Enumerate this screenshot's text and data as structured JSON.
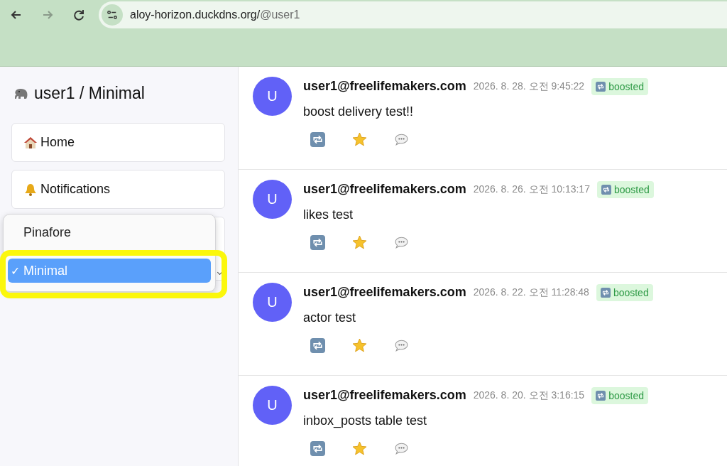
{
  "browser": {
    "url_host": "aloy-horizon.duckdns.org/",
    "url_path": "@user1"
  },
  "sidebar": {
    "title": "user1 / Minimal",
    "nav": [
      {
        "label": "Home",
        "kind": "home"
      },
      {
        "label": "Notifications",
        "kind": "bell"
      }
    ],
    "theme_menu": {
      "options": [
        {
          "label": "Pinafore",
          "selected": false
        },
        {
          "label": "Minimal",
          "selected": true
        }
      ],
      "check": "✓"
    }
  },
  "posts": [
    {
      "avatar": "U",
      "author": "user1@freelifemakers.com",
      "time": "2026. 8. 28. 오전 9:45:22",
      "badge": "boosted",
      "text": "boost delivery test!!"
    },
    {
      "avatar": "U",
      "author": "user1@freelifemakers.com",
      "time": "2026. 8. 26. 오전 10:13:17",
      "badge": "boosted",
      "text": "likes test"
    },
    {
      "avatar": "U",
      "author": "user1@freelifemakers.com",
      "time": "2026. 8. 22. 오전 11:28:48",
      "badge": "boosted",
      "text": "actor test"
    },
    {
      "avatar": "U",
      "author": "user1@freelifemakers.com",
      "time": "2026. 8. 20. 오전 3:16:15",
      "badge": "boosted",
      "text": "inbox_posts table test"
    }
  ]
}
